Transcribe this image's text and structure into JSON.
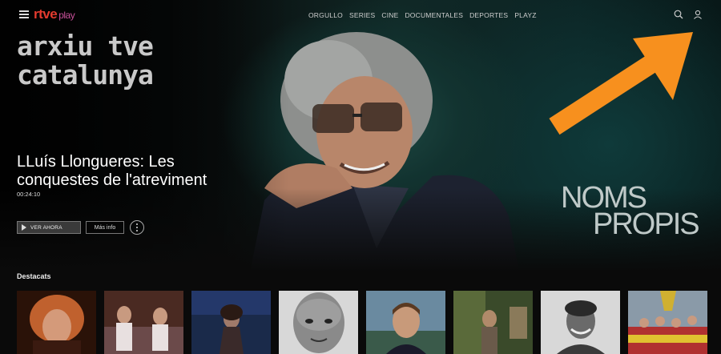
{
  "header": {
    "logo_main": "rtve",
    "logo_sub": "play",
    "nav": [
      "ORGULLO",
      "SERIES",
      "CINE",
      "DOCUMENTALES",
      "DEPORTES",
      "PLAYZ"
    ],
    "icons": [
      "menu-icon",
      "search-icon",
      "user-icon"
    ]
  },
  "hero": {
    "channel_title": "arxiu tve catalunya",
    "program_title": "LLuís Llongueres: Les conquestes de l'atreviment",
    "duration": "00:24:10",
    "watch_label": "VER AHORA",
    "info_label": "Más info",
    "logo_text_line1": "NOMS",
    "logo_text_line2": "PROPIS"
  },
  "section": {
    "title": "Destacats"
  },
  "colors": {
    "brand_red": "#e43b2f",
    "brand_pink": "#c8509a",
    "annotation_arrow": "#f7901e",
    "background": "#0a0a0a"
  }
}
